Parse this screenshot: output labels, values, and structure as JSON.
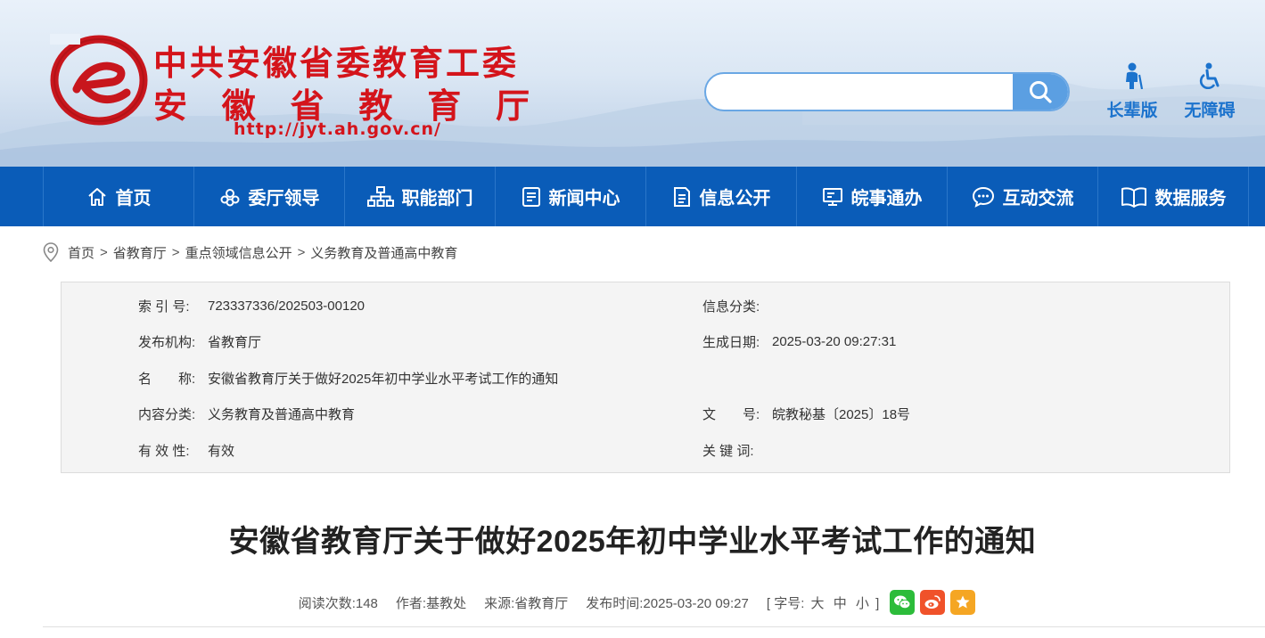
{
  "header": {
    "title_line1": "中共安徽省委教育工委",
    "title_line2_chars": [
      "安",
      "徽",
      "省",
      "教",
      "育",
      "厅"
    ],
    "url": "http://jyt.ah.gov.cn/",
    "search_placeholder": "",
    "elder_label": "长辈版",
    "accessible_label": "无障碍",
    "brand_red": "#d4141b",
    "accent_blue": "#1c73cd"
  },
  "nav": {
    "items": [
      {
        "label": "首页",
        "icon": "home-icon"
      },
      {
        "label": "委厅领导",
        "icon": "leaders-icon"
      },
      {
        "label": "职能部门",
        "icon": "org-chart-icon"
      },
      {
        "label": "新闻中心",
        "icon": "news-icon"
      },
      {
        "label": "信息公开",
        "icon": "document-icon"
      },
      {
        "label": "皖事通办",
        "icon": "monitor-icon"
      },
      {
        "label": "互动交流",
        "icon": "chat-icon"
      },
      {
        "label": "数据服务",
        "icon": "book-icon"
      }
    ],
    "bg_color": "#0a5cb8"
  },
  "breadcrumb": [
    "首页",
    "省教育厅",
    "重点领域信息公开",
    "义务教育及普通高中教育"
  ],
  "info": {
    "index_label": "索 引 号:",
    "index_value": "723337336/202503-00120",
    "category_label": "信息分类:",
    "category_value": "",
    "publisher_label": "发布机构:",
    "publisher_value": "省教育厅",
    "date_label": "生成日期:",
    "date_value": "2025-03-20 09:27:31",
    "name_label": "名　　称:",
    "name_value": "安徽省教育厅关于做好2025年初中学业水平考试工作的通知",
    "content_label": "内容分类:",
    "content_value": "义务教育及普通高中教育",
    "docno_label": "文　　号:",
    "docno_value": "皖教秘基〔2025〕18号",
    "validity_label": "有 效 性:",
    "validity_value": "有效",
    "keywords_label": "关 键 词:",
    "keywords_value": ""
  },
  "article": {
    "title": "安徽省教育厅关于做好2025年初中学业水平考试工作的通知",
    "reads": "阅读次数:148",
    "author": "作者:基教处",
    "source": "来源:省教育厅",
    "published": "发布时间:2025-03-20 09:27",
    "font_size_open": "[ 字号:",
    "font_large": "大",
    "font_medium": "中",
    "font_small": "小",
    "font_size_close": "]",
    "share_colors": {
      "wechat": "#2cbc3a",
      "weibo": "#f0522a",
      "favorite": "#f5a623"
    }
  }
}
